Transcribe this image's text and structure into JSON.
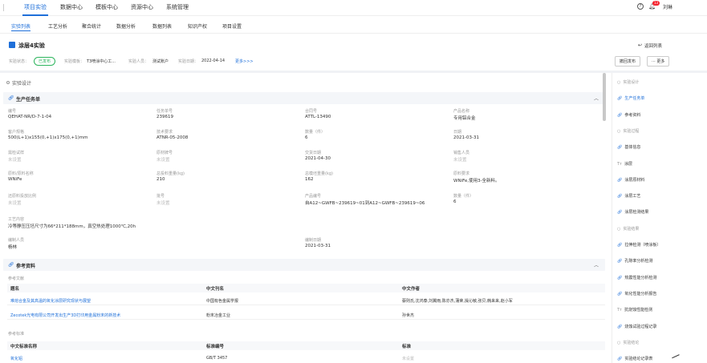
{
  "topnav": {
    "items": [
      "项目实验",
      "数据中心",
      "模板中心",
      "资源中心",
      "系统管理"
    ],
    "notif_count": "13",
    "user_name": "刘琳"
  },
  "subnav": {
    "tabs": [
      "实验列表",
      "工艺分析",
      "聚合统计",
      "数据分析",
      "数据列表",
      "知识产权",
      "项目设置"
    ]
  },
  "experiment": {
    "title": "涂层4实验",
    "back_label": "返回列表",
    "status_label": "实验状态：",
    "status_value": "已发布",
    "template_label": "实验模板：",
    "template_value": "T3喷涂中心工...",
    "person_label": "实验人员：",
    "person_value": "测试账户",
    "date_label": "实验日期：",
    "date_value": "2022-04-14",
    "more_link": "更多>>>",
    "unpublish_button": "撤回发布",
    "more_button": "··· 更多"
  },
  "design": {
    "title": "实验设计"
  },
  "production": {
    "title": "生产任务单",
    "fields": [
      {
        "label": "编号",
        "value": "QEHAT-NR/D-7-1-04",
        "placeholder": false
      },
      {
        "label": "任务单号",
        "value": "239619",
        "placeholder": false
      },
      {
        "label": "合同号",
        "value": "ATTL-13490",
        "placeholder": false
      },
      {
        "label": "产品名称",
        "value": "专用铝合金",
        "placeholder": false
      },
      {
        "label": "客户规格",
        "value": "500(L+1)x155(0,+1)x175(0,+1)mm",
        "placeholder": false
      },
      {
        "label": "技术要求",
        "value": "ATNR-05-2008",
        "placeholder": false
      },
      {
        "label": "数量（件）",
        "value": "6",
        "placeholder": false
      },
      {
        "label": "日期",
        "value": "2021-03-31",
        "placeholder": false
      },
      {
        "label": "需检试样",
        "value": "未设置",
        "placeholder": true
      },
      {
        "label": "原材牌号",
        "value": "未设置",
        "placeholder": true
      },
      {
        "label": "交货日期",
        "value": "2021-04-30",
        "placeholder": false
      },
      {
        "label": "销售人员",
        "value": "未设置",
        "placeholder": true
      },
      {
        "label": "原料/原料名称",
        "value": "WNiFe",
        "placeholder": false
      },
      {
        "label": "总投料重量(kg)",
        "value": "210",
        "placeholder": false
      },
      {
        "label": "总模坯重量(kg)",
        "value": "162",
        "placeholder": false
      },
      {
        "label": "原料要求",
        "value": "WNiFe,使用3-全新料。",
        "placeholder": false
      },
      {
        "label": "还原料投放比例",
        "value": "未设置",
        "placeholder": true
      },
      {
        "label": "批号",
        "value": "未设置",
        "placeholder": true
      },
      {
        "label": "产品编号",
        "value": "自A12~GWFB~239619~01到A12~GWFB~239619~06",
        "placeholder": false
      },
      {
        "label": "数量（件）",
        "value": "6",
        "placeholder": false
      }
    ],
    "process_label": "工艺内容",
    "process_value": "冷等静压压坯尺寸为66*211*188mm，真空热处理1000℃,20h",
    "editor_label": "编制人员",
    "editor_value": "杨林",
    "edit_date_label": "编制日期",
    "edit_date_value": "2021-03-31"
  },
  "references": {
    "title": "参考资料",
    "lit_label": "参考文献",
    "lit_headers": [
      "题名",
      "中文刊名",
      "中文作者"
    ],
    "lit_rows": [
      [
        "难熔合金及其高温的氧化涂层研究现状与展望",
        "中国有色金属学报",
        "蔡则氏,沈鸿泰,刘翼雨,陈亦杰,蒲荣,操沁敏,张贝,韩来来,赵小军"
      ],
      [
        "Zecotek光电有限公司开发出生产3D打印用金属粉末的新技术",
        "粉末冶金工业",
        "孙世杰"
      ]
    ],
    "std_label": "参考标准",
    "std_headers": [
      "中文标准名称",
      "标准编号",
      "标准"
    ],
    "std_rows": [
      [
        "氧化铝",
        "GB/T 3457",
        "未设置"
      ]
    ]
  },
  "right_sidebar": {
    "items": [
      {
        "label": "实验设计",
        "kind": "group",
        "icon": "circle-icon"
      },
      {
        "label": "生产任务单",
        "kind": "active",
        "icon": "link-icon"
      },
      {
        "label": "参考资料",
        "kind": "item",
        "icon": "link-icon"
      },
      {
        "label": "实验过程",
        "kind": "group",
        "icon": "circle-icon"
      },
      {
        "label": "基体信息",
        "kind": "item",
        "icon": "link-icon"
      },
      {
        "label": "涂层",
        "kind": "item",
        "icon": "text-icon"
      },
      {
        "label": "涂层原材料",
        "kind": "item",
        "icon": "link-icon"
      },
      {
        "label": "涂层工艺",
        "kind": "item",
        "icon": "link-icon"
      },
      {
        "label": "涂层检测结果",
        "kind": "item",
        "icon": "link-icon"
      },
      {
        "label": "实验结果",
        "kind": "group",
        "icon": "circle-icon"
      },
      {
        "label": "拉伸检测（喷涂板）",
        "kind": "item",
        "icon": "link-icon"
      },
      {
        "label": "孔隙率分析检测",
        "kind": "item",
        "icon": "link-icon"
      },
      {
        "label": "热震性能分析检测",
        "kind": "item",
        "icon": "link-icon"
      },
      {
        "label": "氧化性能分析报告",
        "kind": "item",
        "icon": "link-icon"
      },
      {
        "label": "抗烧蚀性能检测",
        "kind": "item",
        "icon": "text-icon"
      },
      {
        "label": "烧蚀试验过程记录",
        "kind": "item",
        "icon": "link-icon"
      },
      {
        "label": "实验结论",
        "kind": "group",
        "icon": "circle-icon"
      },
      {
        "label": "实验结论记录表",
        "kind": "item",
        "icon": "link-icon"
      }
    ]
  },
  "colors": {
    "accent": "#1e6fd9",
    "status_green": "#2db55d"
  }
}
